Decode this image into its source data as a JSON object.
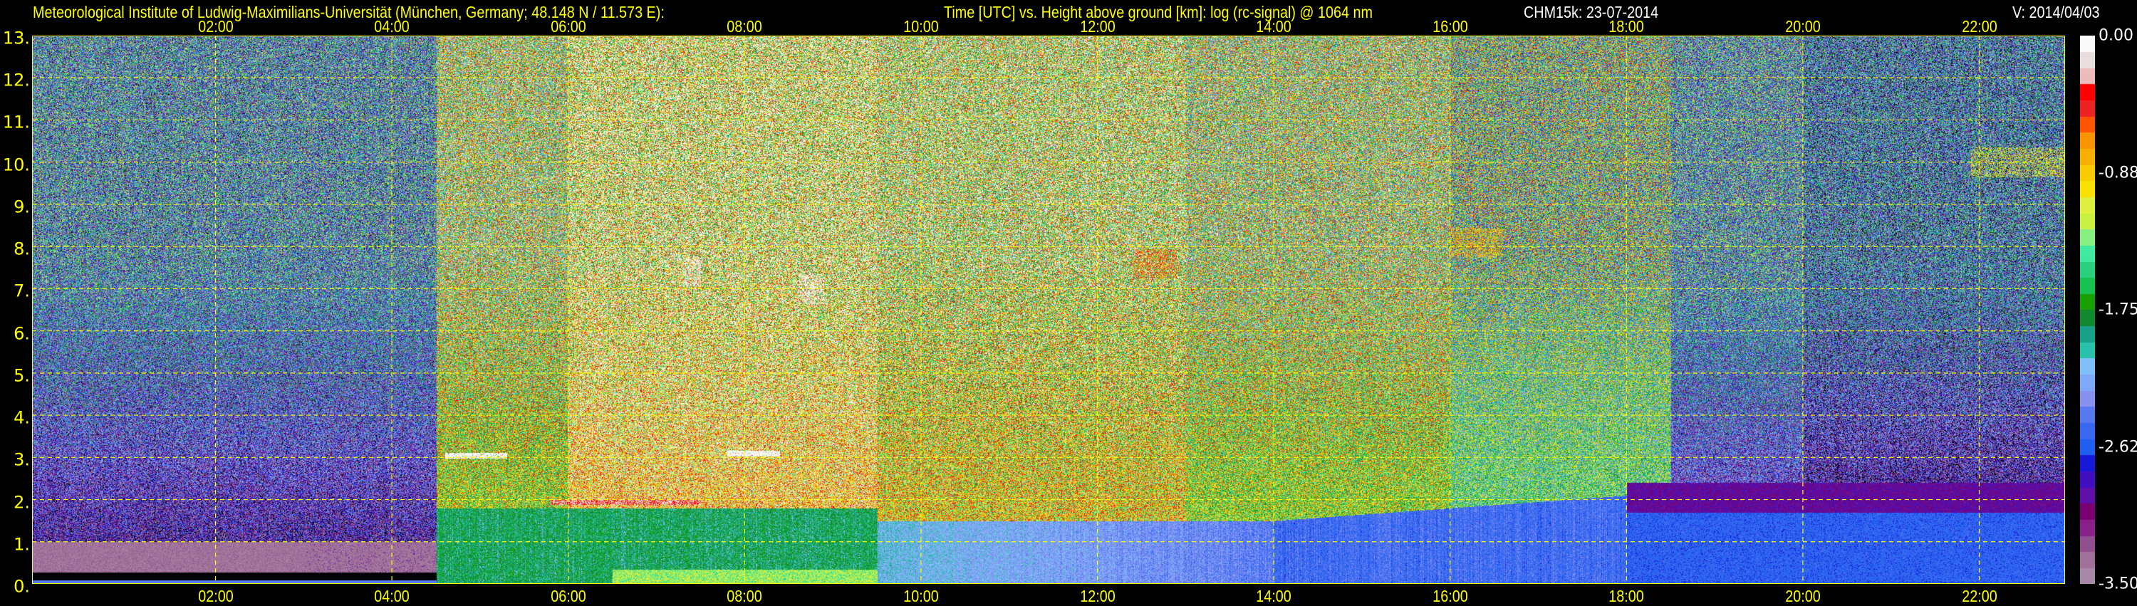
{
  "header": {
    "institute": "Meteorological Institute of Ludwig-Maximilians-Universität (München, Germany; 48.148 N / 11.573 E):",
    "description": "Time [UTC] vs. Height above ground [km]: log (rc-signal) @ 1064 nm",
    "instrument_date": "CHM15k: 23-07-2014",
    "version": "V: 2014/04/03"
  },
  "chart_data": {
    "type": "heatmap",
    "title": "Time [UTC] vs. Height above ground [km]: log (rc-signal) @ 1064 nm",
    "xlabel": "Time [UTC]",
    "ylabel": "Height above ground [km]",
    "xlim_hours": [
      0.08,
      23.15
    ],
    "ylim": [
      0,
      13
    ],
    "x_ticks": [
      "02:00",
      "04:00",
      "06:00",
      "08:00",
      "10:00",
      "12:00",
      "14:00",
      "16:00",
      "18:00",
      "20:00",
      "22:00"
    ],
    "x_tick_hours": [
      2,
      4,
      6,
      8,
      10,
      12,
      14,
      16,
      18,
      20,
      22
    ],
    "y_ticks": [
      "13.",
      "12.",
      "11.",
      "10.",
      "9.",
      "8.",
      "7.",
      "6.",
      "5.",
      "4.",
      "3.",
      "2.",
      "1.",
      "0."
    ],
    "y_tick_values": [
      13,
      12,
      11,
      10,
      9,
      8,
      7,
      6,
      5,
      4,
      3,
      2,
      1,
      0
    ],
    "grid": true,
    "colorbar": {
      "range": [
        -3.5,
        0.0
      ],
      "tick_labels": [
        "0.00",
        "-0.88",
        "-1.75",
        "-2.62",
        "-3.50"
      ],
      "tick_values": [
        0.0,
        -0.875,
        -1.75,
        -2.625,
        -3.5
      ],
      "colors_top_to_bottom": [
        "#fafafa",
        "#e8dede",
        "#ecbcbc",
        "#ff0000",
        "#ee2222",
        "#ff5500",
        "#f89400",
        "#f8b000",
        "#f8cc00",
        "#f8e000",
        "#e0f040",
        "#c8f040",
        "#88f080",
        "#40e8a0",
        "#28d080",
        "#18c050",
        "#18a000",
        "#108830",
        "#18a088",
        "#28c0a8",
        "#80c0f8",
        "#80a8f8",
        "#8890f0",
        "#5878f0",
        "#3868f0",
        "#2060f0",
        "#1818d8",
        "#4010c0",
        "#6010a8",
        "#780070",
        "#882088",
        "#905090",
        "#a07098",
        "#a888a8"
      ]
    },
    "features": [
      {
        "name": "cloud",
        "t": [
          4.6,
          5.3
        ],
        "height_km": 3.05,
        "value": 0.0
      },
      {
        "name": "cloud",
        "t": [
          7.8,
          8.4
        ],
        "height_km": 3.1,
        "value": 0.0
      },
      {
        "name": "cloud",
        "t": [
          5.8,
          7.5
        ],
        "height_km": 1.95,
        "value": -0.3
      },
      {
        "name": "cirrus",
        "t": [
          7.3,
          7.5
        ],
        "height_km": 7.4,
        "value": -0.1
      },
      {
        "name": "cirrus",
        "t": [
          8.6,
          8.9
        ],
        "height_km": 7.0,
        "value": -0.1
      },
      {
        "name": "cirrus",
        "t": [
          12.4,
          12.9
        ],
        "height_km": 7.6,
        "value": -0.6
      },
      {
        "name": "cirrus",
        "t": [
          16.0,
          16.6
        ],
        "height_km": 8.1,
        "value": -0.8
      },
      {
        "name": "cirrus",
        "t": [
          21.9,
          23.0
        ],
        "height_km": 10.0,
        "value": -1.0
      }
    ]
  }
}
